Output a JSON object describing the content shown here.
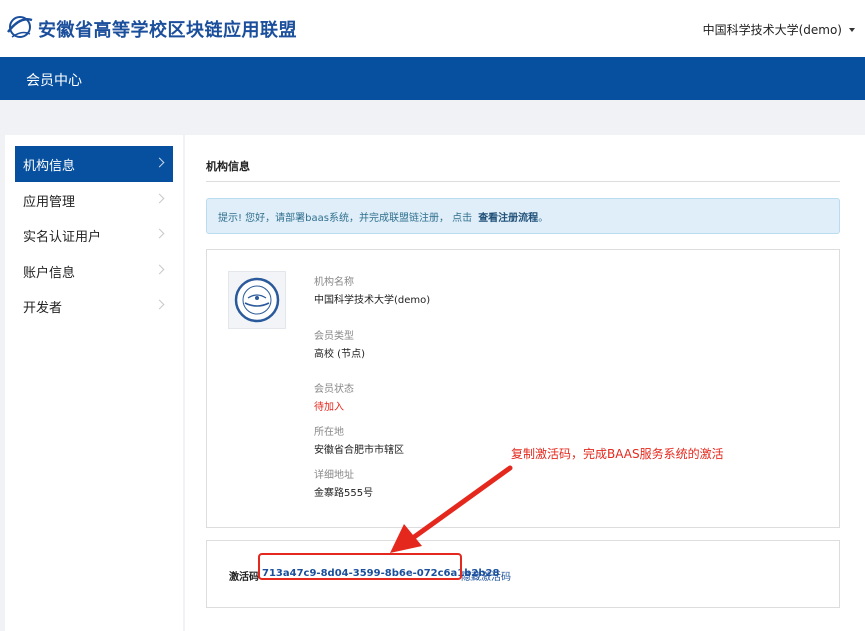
{
  "header": {
    "brand": "安徽省高等学校区块链应用联盟",
    "user": "中国科学技术大学(demo)",
    "logo_icon": "globe-swoosh-icon",
    "caret_icon": "caret-down-icon"
  },
  "navbar": {
    "title": "会员中心"
  },
  "sidebar": {
    "items": [
      {
        "label": "机构信息",
        "active": true
      },
      {
        "label": "应用管理",
        "active": false
      },
      {
        "label": "实名认证用户",
        "active": false
      },
      {
        "label": "账户信息",
        "active": false
      },
      {
        "label": "开发者",
        "active": false
      }
    ]
  },
  "main": {
    "title": "机构信息",
    "alert": {
      "text": "提示! 您好，请部署baas系统，并完成联盟链注册， 点击",
      "link": "查看注册流程",
      "tail": "。"
    },
    "fields": [
      {
        "label": "机构名称",
        "value": "中国科学技术大学(demo)"
      },
      {
        "label": "会员类型",
        "value": "高校 (节点)"
      },
      {
        "label": "会员状态",
        "value": "待加入",
        "status": "warning"
      },
      {
        "label": "所在地",
        "value": "安徽省合肥市市辖区"
      },
      {
        "label": "详细地址",
        "value": "金寨路555号"
      }
    ],
    "activation": {
      "label": "激活码",
      "code": "713a47c9-8d04-3599-8b6e-072c6a1b2b28",
      "toggle": "隐藏激活码"
    }
  },
  "annotation": {
    "text": "复制激活码，完成BAAS服务系统的激活",
    "color": "#e5281d"
  },
  "colors": {
    "primary": "#07509f",
    "brand_text": "#1b4f9c",
    "alert_bg": "#dfeef8",
    "warning": "#e5281d"
  }
}
